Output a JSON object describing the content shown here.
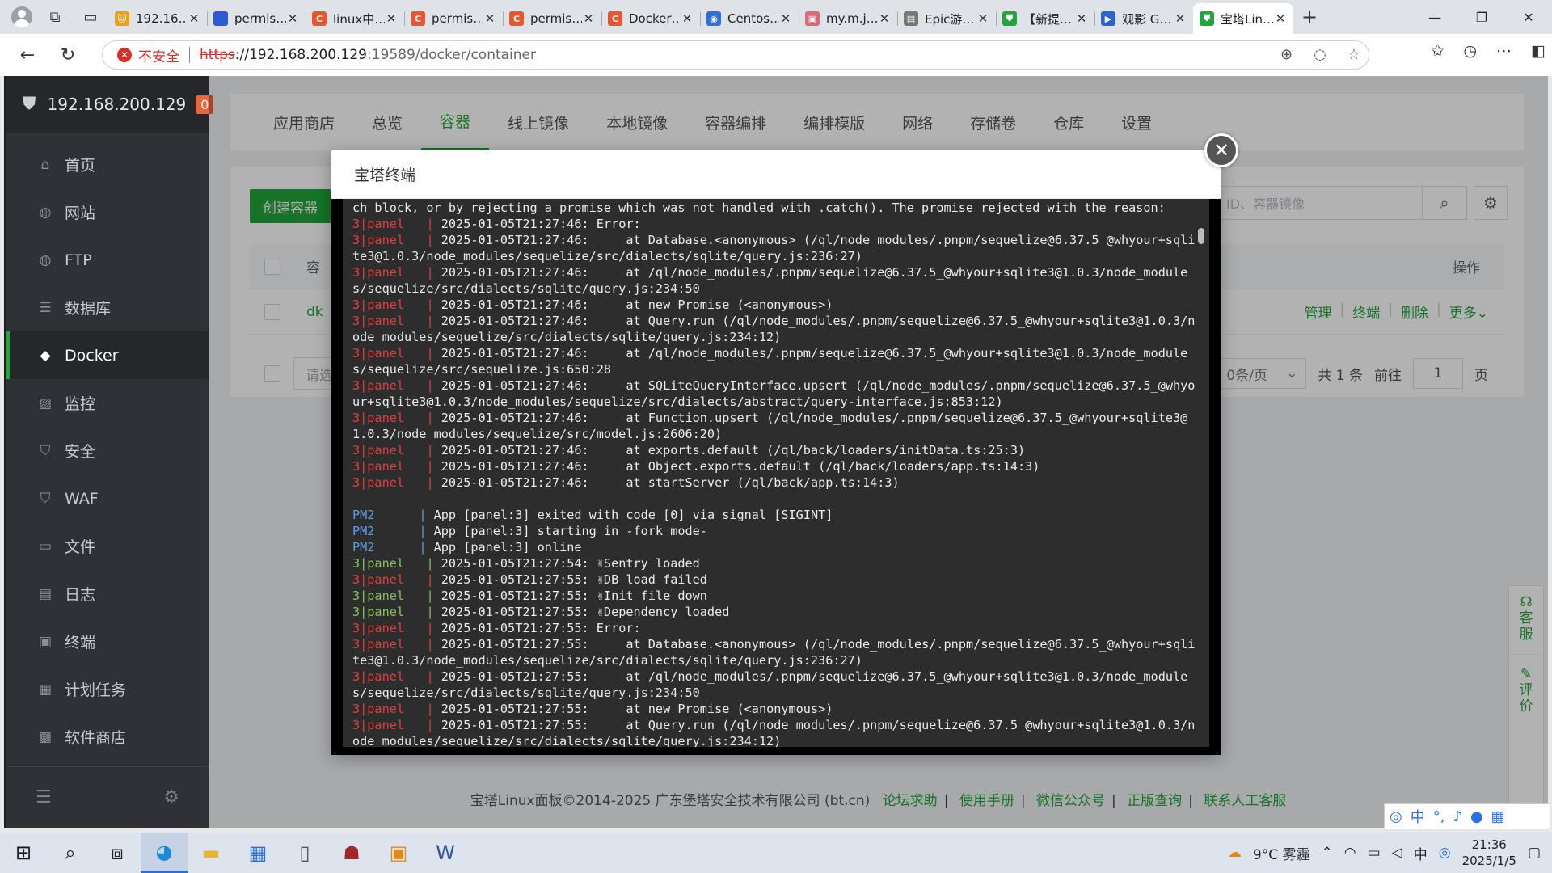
{
  "browser": {
    "tabs": [
      {
        "title": "192.16…",
        "color": "#e8a11a",
        "glyph": "🐱"
      },
      {
        "title": "permis…",
        "color": "#3157d8",
        "glyph": "🐾"
      },
      {
        "title": "linux中…",
        "color": "#e9552f",
        "glyph": "C"
      },
      {
        "title": "permis…",
        "color": "#e9552f",
        "glyph": "C"
      },
      {
        "title": "permis…",
        "color": "#e9552f",
        "glyph": "C"
      },
      {
        "title": "Docker…",
        "color": "#e9552f",
        "glyph": "C"
      },
      {
        "title": "Centos…",
        "color": "#2f6fd8",
        "glyph": "◉"
      },
      {
        "title": "my.m.j…",
        "color": "#d86a7a",
        "glyph": "▣"
      },
      {
        "title": "Epic游…",
        "color": "#777777",
        "glyph": "▤"
      },
      {
        "title": "【新提…",
        "color": "#20a53a",
        "glyph": "⛊"
      },
      {
        "title": "观影 G…",
        "color": "#2a63c9",
        "glyph": "▶"
      },
      {
        "title": "宝塔Lin…",
        "color": "#20a53a",
        "glyph": "⛊",
        "active": true
      }
    ],
    "address": {
      "insecure_label": "不安全",
      "scheme": "https",
      "host": "://192.168.200.129",
      "rest": ":19589/docker/container"
    }
  },
  "sidebar": {
    "host": "192.168.200.129",
    "badge": "0",
    "items": [
      {
        "label": "首页",
        "icon": "home-icon",
        "glyph": "⌂"
      },
      {
        "label": "网站",
        "icon": "globe-icon",
        "glyph": "◍"
      },
      {
        "label": "FTP",
        "icon": "ftp-icon",
        "glyph": "◍"
      },
      {
        "label": "数据库",
        "icon": "database-icon",
        "glyph": "☰"
      },
      {
        "label": "Docker",
        "icon": "docker-icon",
        "glyph": "◆",
        "active": true
      },
      {
        "label": "监控",
        "icon": "monitor-icon",
        "glyph": "▨"
      },
      {
        "label": "安全",
        "icon": "shield-icon",
        "glyph": "⛉"
      },
      {
        "label": "WAF",
        "icon": "waf-icon",
        "glyph": "⛉"
      },
      {
        "label": "文件",
        "icon": "folder-icon",
        "glyph": "▭"
      },
      {
        "label": "日志",
        "icon": "log-icon",
        "glyph": "▤"
      },
      {
        "label": "终端",
        "icon": "terminal-icon",
        "glyph": "▣"
      },
      {
        "label": "计划任务",
        "icon": "calendar-icon",
        "glyph": "▦"
      },
      {
        "label": "软件商店",
        "icon": "apps-icon",
        "glyph": "▩"
      }
    ]
  },
  "topnav": [
    "应用商店",
    "总览",
    "容器",
    "线上镜像",
    "本地镜像",
    "容器编排",
    "编排模版",
    "网络",
    "存储卷",
    "仓库",
    "设置"
  ],
  "content": {
    "create_label": "创建容器",
    "search_placeholder": "名、ID、容器镜像",
    "col_name": "容",
    "col_ops": "操作",
    "row_name": "dk",
    "actions": [
      "管理",
      "终端",
      "删除",
      "更多"
    ],
    "batch_placeholder": "请选",
    "per_page": "0条/页",
    "total": "共 1 条",
    "goto": "前往",
    "page": "1",
    "page_unit": "页"
  },
  "modal": {
    "title": "宝塔终端"
  },
  "footer": {
    "copyright": "宝塔Linux面板©2014-2025 广东堡塔安全技术有限公司 (bt.cn)",
    "links": [
      "论坛求助",
      "使用手册",
      "微信公众号",
      "正版查询",
      "联系人工客服"
    ]
  },
  "float": [
    "客服",
    "评价"
  ],
  "taskbar": {
    "weather": "9°C 雾霾",
    "ime": "中",
    "time": "21:36",
    "date": "2025/1/5"
  },
  "terminal": [
    {
      "t": "txt",
      "s": "ch block, or by rejecting a promise which was not handled with .catch(). The promise rejected with the reason:"
    },
    {
      "t": "red",
      "s": "2025-01-05T21:27:46: Error:"
    },
    {
      "t": "red",
      "s": "2025-01-05T21:27:46:     at Database.<anonymous> (/ql/node_modules/.pnpm/sequelize@6.37.5_@whyour+sqlite3@1.0.3/node_modules/sequelize/src/dialects/sqlite/query.js:236:27)"
    },
    {
      "t": "red",
      "s": "2025-01-05T21:27:46:     at /ql/node_modules/.pnpm/sequelize@6.37.5_@whyour+sqlite3@1.0.3/node_modules/sequelize/src/dialects/sqlite/query.js:234:50"
    },
    {
      "t": "red",
      "s": "2025-01-05T21:27:46:     at new Promise (<anonymous>)"
    },
    {
      "t": "red",
      "s": "2025-01-05T21:27:46:     at Query.run (/ql/node_modules/.pnpm/sequelize@6.37.5_@whyour+sqlite3@1.0.3/node_modules/sequelize/src/dialects/sqlite/query.js:234:12)"
    },
    {
      "t": "red",
      "s": "2025-01-05T21:27:46:     at /ql/node_modules/.pnpm/sequelize@6.37.5_@whyour+sqlite3@1.0.3/node_modules/sequelize/src/sequelize.js:650:28"
    },
    {
      "t": "red",
      "s": "2025-01-05T21:27:46:     at SQLiteQueryInterface.upsert (/ql/node_modules/.pnpm/sequelize@6.37.5_@whyour+sqlite3@1.0.3/node_modules/sequelize/src/dialects/abstract/query-interface.js:853:12)"
    },
    {
      "t": "red",
      "s": "2025-01-05T21:27:46:     at Function.upsert (/ql/node_modules/.pnpm/sequelize@6.37.5_@whyour+sqlite3@1.0.3/node_modules/sequelize/src/model.js:2606:20)"
    },
    {
      "t": "red",
      "s": "2025-01-05T21:27:46:     at exports.default (/ql/back/loaders/initData.ts:25:3)"
    },
    {
      "t": "red",
      "s": "2025-01-05T21:27:46:     at Object.exports.default (/ql/back/loaders/app.ts:14:3)"
    },
    {
      "t": "red",
      "s": "2025-01-05T21:27:46:     at startServer (/ql/back/app.ts:14:3)"
    },
    {
      "t": "blank",
      "s": ""
    },
    {
      "t": "pm2",
      "s": "App [panel:3] exited with code [0] via signal [SIGINT]"
    },
    {
      "t": "pm2",
      "s": "App [panel:3] starting in -fork mode-"
    },
    {
      "t": "pm2",
      "s": "App [panel:3] online"
    },
    {
      "t": "grn",
      "s": "2025-01-05T21:27:54: ✌Sentry loaded"
    },
    {
      "t": "red",
      "s": "2025-01-05T21:27:55: ✌DB load failed"
    },
    {
      "t": "grn",
      "s": "2025-01-05T21:27:55: ✌Init file down"
    },
    {
      "t": "grn",
      "s": "2025-01-05T21:27:55: ✌Dependency loaded"
    },
    {
      "t": "red",
      "s": "2025-01-05T21:27:55: Error:"
    },
    {
      "t": "red",
      "s": "2025-01-05T21:27:55:     at Database.<anonymous> (/ql/node_modules/.pnpm/sequelize@6.37.5_@whyour+sqlite3@1.0.3/node_modules/sequelize/src/dialects/sqlite/query.js:236:27)"
    },
    {
      "t": "red",
      "s": "2025-01-05T21:27:55:     at /ql/node_modules/.pnpm/sequelize@6.37.5_@whyour+sqlite3@1.0.3/node_modules/sequelize/src/dialects/sqlite/query.js:234:50"
    },
    {
      "t": "red",
      "s": "2025-01-05T21:27:55:     at new Promise (<anonymous>)"
    },
    {
      "t": "red",
      "s": "2025-01-05T21:27:55:     at Query.run (/ql/node_modules/.pnpm/sequelize@6.37.5_@whyour+sqlite3@1.0.3/node_modules/sequelize/src/dialects/sqlite/query.js:234:12)"
    }
  ]
}
